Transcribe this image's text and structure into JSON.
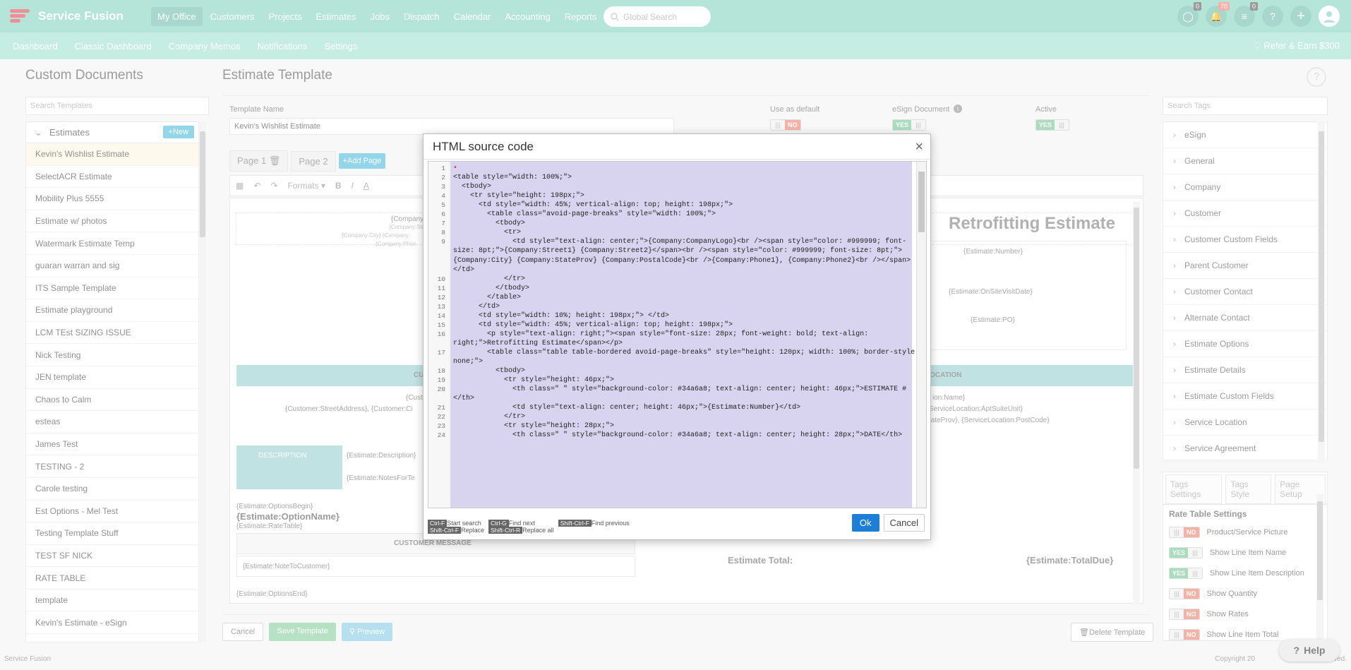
{
  "app": {
    "name": "Service Fusion"
  },
  "topnav": {
    "items": [
      "My Office",
      "Customers",
      "Projects",
      "Estimates",
      "Jobs",
      "Dispatch",
      "Calendar",
      "Accounting",
      "Reports"
    ],
    "search_placeholder": "Global Search",
    "badges": {
      "chat": "0",
      "notifications": "70",
      "tasks": "0"
    }
  },
  "subnav": {
    "items": [
      "Dashboard",
      "Classic Dashboard",
      "Company Memos",
      "Notifications",
      "Settings"
    ],
    "refer": "Refer & Earn $300"
  },
  "left": {
    "title": "Custom Documents",
    "search_placeholder": "Search Templates",
    "group": "Estimates",
    "new_label": "New",
    "templates": [
      "Kevin's Wishlist Estimate",
      "SelectACR Estimate",
      "Mobility Plus 5555",
      "Estimate w/ photos",
      "Watermark Estimate Temp",
      "guaran warran and sig",
      "ITS Sample Template",
      "Estimate playground",
      "LCM TEst SIZING ISSUE",
      "Nick Testing",
      "JEN template",
      "Chaos to Calm",
      "esteas",
      "James Test",
      "TESTING - 2",
      "Carole testing",
      "Est Options - Mel Test",
      "Testing Template Stuff",
      "TEST SF NICK",
      "RATE TABLE",
      "template",
      "Kevin's Estimate - eSign"
    ]
  },
  "editor": {
    "title": "Estimate Template",
    "template_name_label": "Template Name",
    "template_name": "Kevin's Wishlist Estimate",
    "use_default_label": "Use as default",
    "esign_label": "eSign Document",
    "active_label": "Active",
    "toggle_yes": "YES",
    "toggle_no": "NO",
    "pages": [
      "Page 1",
      "Page 2"
    ],
    "add_page": "Add Page",
    "formats": "Formats",
    "doc_text": {
      "company": "{Company",
      "company_street": "{Company:Stre",
      "company_city": "{Company:City} {Company:",
      "company_phone": "{Company:Phon",
      "heading": "Retrofitting Estimate",
      "est_number": "{Estimate:Number}",
      "onsite": "{Estimate:OnSiteVisitDate}",
      "po": "{Estimate:PO}",
      "cust_head": "CU",
      "location_head": "LOCATION",
      "cust_line1": "{Cust",
      "cust_line2": "{Customer:StreetAddress}, {Customer:Ci",
      "loc_line1": "ion:Name}",
      "loc_line2": "ServiceLocation:AptSuiteUnit}",
      "loc_line3": "tateProv}, {ServiceLocation:PostCode}",
      "description": "DESCRIPTION",
      "est_desc": "{Estimate:Description}",
      "notes": "{Estimate:NotesForTe",
      "options_begin": "{Estimate:OptionsBegin}",
      "option_name": "{Estimate:OptionName}",
      "rate_table": "{Estimate:RateTable}",
      "customer_message": "CUSTOMER MESSAGE",
      "note_to_customer": "{Estimate:NoteToCustomer}",
      "estimate_total": "Estimate Total:",
      "total_due": "{Estimate:TotalDue}",
      "options_end": "{Estimate:OptionsEnd}"
    },
    "buttons": {
      "cancel": "Cancel",
      "save": "Save Template",
      "preview": "Preview",
      "delete": "Delete Template"
    }
  },
  "right": {
    "search_placeholder": "Search Tags",
    "tags": [
      "eSign",
      "General",
      "Company",
      "Customer",
      "Customer Custom Fields",
      "Parent Customer",
      "Customer Contact",
      "Alternate Contact",
      "Estimate Options",
      "Estimate Details",
      "Estimate Custom Fields",
      "Service Location",
      "Service Agreement"
    ],
    "tabs": [
      "Tags Settings",
      "Tags Style",
      "Page Setup"
    ],
    "rate_title": "Rate Table Settings",
    "settings": [
      {
        "label": "Product/Service Picture",
        "value": "NO"
      },
      {
        "label": "Show Line Item Name",
        "value": "YES"
      },
      {
        "label": "Show Line Item Description",
        "value": "YES"
      },
      {
        "label": "Show Quantity",
        "value": "NO"
      },
      {
        "label": "Show Rates",
        "value": "NO"
      },
      {
        "label": "Show Line Item Total",
        "value": "NO"
      }
    ]
  },
  "footer": {
    "left": "Service Fusion",
    "right": "Copyright 20",
    "right_tail": "ved."
  },
  "help": "Help",
  "modal": {
    "title": "HTML source code",
    "line_numbers": [
      "1",
      "2",
      "3",
      "4",
      "5",
      "6",
      "7",
      "8",
      "9",
      "",
      "",
      "",
      "10",
      "11",
      "12",
      "13",
      "14",
      "15",
      "16",
      "",
      "17",
      "",
      "18",
      "19",
      "20",
      "",
      "21",
      "22",
      "23",
      "24"
    ],
    "code_lines": [
      "•",
      "<table style=\"width: 100%;\">",
      "  <tbody>",
      "    <tr style=\"height: 198px;\">",
      "      <td style=\"width: 45%; vertical-align: top; height: 198px;\">",
      "        <table class=\"avoid-page-breaks\" style=\"width: 100%;\">",
      "          <tbody>",
      "            <tr>",
      "              <td style=\"text-align: center;\">{Company:CompanyLogo}<br /><span style=\"color: #999999; font-",
      "size: 8pt;\">{Company:Street1} {Company:Street2}</span><br /><span style=\"color: #999999; font-size: 8pt;\">",
      "{Company:City} {Company:StateProv} {Company:PostalCode}<br />{Company:Phone1}, {Company:Phone2}<br /></span>",
      "</td>",
      "            </tr>",
      "          </tbody>",
      "        </table>",
      "      </td>",
      "      <td style=\"width: 10%; height: 198px;\"> </td>",
      "      <td style=\"width: 45%; vertical-align: top; height: 198px;\">",
      "        <p style=\"text-align: right;\"><span style=\"font-size: 28px; font-weight: bold; text-align:",
      "right;\">Retrofitting Estimate</span></p>",
      "        <table class=\"table table-bordered avoid-page-breaks\" style=\"height: 120px; width: 100%; border-style:",
      "none;\">",
      "          <tbody>",
      "            <tr style=\"height: 46px;\">",
      "              <th class=\" \" style=\"background-color: #34a6a8; text-align: center; height: 46px;\">ESTIMATE #",
      "</th>",
      "              <td style=\"text-align: center; height: 46px;\">{Estimate:Number}</td>",
      "            </tr>",
      "            <tr style=\"height: 28px;\">",
      "              <th class=\" \" style=\"background-color: #34a6a8; text-align: center; height: 28px;\">DATE</th>"
    ],
    "hints": [
      {
        "key1": "Ctrl-F",
        "desc1": "Start search",
        "key2": "Shift-Ctrl-F",
        "desc2": "Replace"
      },
      {
        "key1": "Ctrl-G",
        "desc1": "Find next",
        "key2": "Shift-Ctrl-R",
        "desc2": "Replace all"
      },
      {
        "key1": "Shift-Ctrl-F",
        "desc1": "Find previous",
        "key2": "",
        "desc2": ""
      }
    ],
    "ok": "Ok",
    "cancel": "Cancel"
  }
}
